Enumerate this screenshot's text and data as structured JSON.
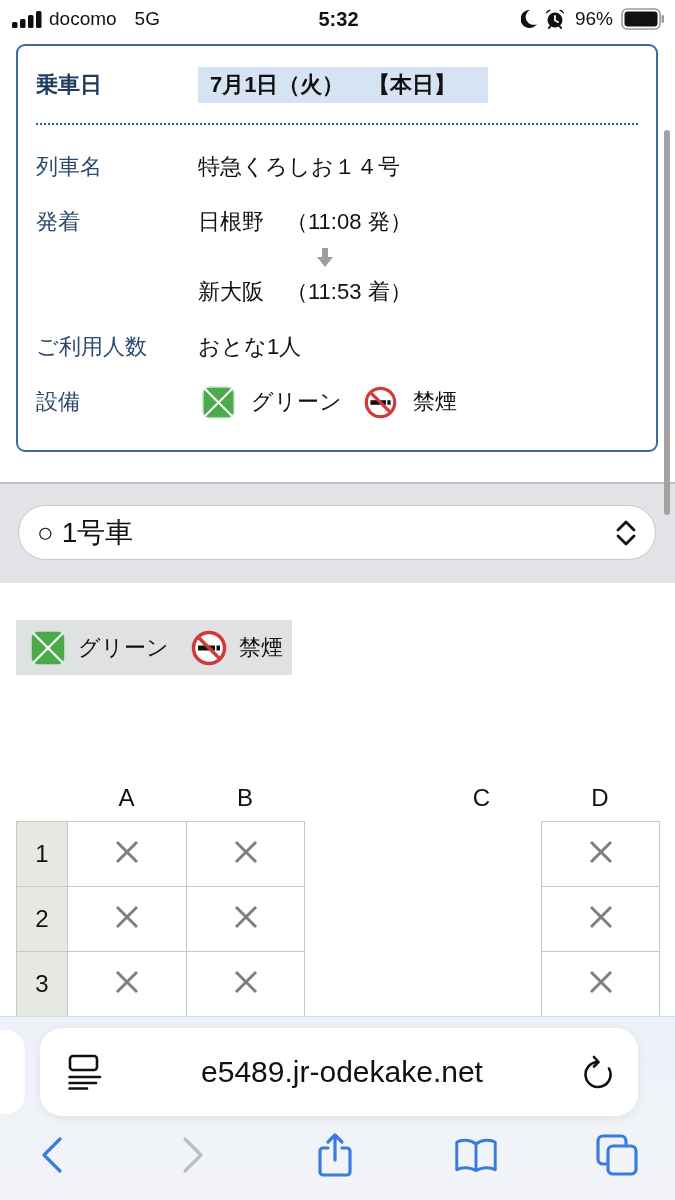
{
  "status_bar": {
    "carrier": "docomo",
    "network": "5G",
    "time": "5:32",
    "battery": "96%"
  },
  "ticket": {
    "date": {
      "label": "乗車日",
      "value": "7月1日（火）",
      "note": "【本日】"
    },
    "rows": [
      {
        "kind": "text",
        "label": "列車名",
        "value": "特急くろしお１４号"
      },
      {
        "kind": "route",
        "label": "発着",
        "departure": {
          "station": "日根野",
          "time": "（11:08 発）"
        },
        "arrival": {
          "station": "新大阪",
          "time": "（11:53 着）"
        }
      },
      {
        "kind": "text",
        "label": "ご利用人数",
        "value": "おとな1人"
      },
      {
        "kind": "facilities",
        "label": "設備",
        "items": [
          {
            "kind": "green",
            "label": "グリーン"
          },
          {
            "kind": "no_smoking",
            "label": "禁煙"
          }
        ]
      }
    ]
  },
  "car_select": {
    "value": "○ 1号車"
  },
  "legend": [
    {
      "kind": "green",
      "label": "グリーン"
    },
    {
      "kind": "no_smoking",
      "label": "禁煙"
    }
  ],
  "seat_map": {
    "columns": [
      {
        "kind": "seat",
        "label": "A"
      },
      {
        "kind": "seat",
        "label": "B"
      },
      {
        "kind": "aisle"
      },
      {
        "kind": "seat",
        "label": "C"
      },
      {
        "kind": "seat",
        "label": "D"
      }
    ],
    "rows": [
      {
        "number": "1",
        "seats": [
          {
            "kind": "seat",
            "available": false
          },
          {
            "kind": "seat",
            "available": false
          },
          {
            "kind": "none"
          },
          {
            "kind": "seat",
            "available": false
          }
        ]
      },
      {
        "number": "2",
        "seats": [
          {
            "kind": "seat",
            "available": false
          },
          {
            "kind": "seat",
            "available": false
          },
          {
            "kind": "none"
          },
          {
            "kind": "seat",
            "available": false
          }
        ]
      },
      {
        "number": "3",
        "seats": [
          {
            "kind": "seat",
            "available": false
          },
          {
            "kind": "seat",
            "available": false
          },
          {
            "kind": "none"
          },
          {
            "kind": "seat",
            "available": false
          }
        ]
      }
    ]
  },
  "browser": {
    "url": "e5489.jr-odekake.net",
    "toolbar": [
      {
        "kind": "back",
        "disabled": false
      },
      {
        "kind": "forward",
        "disabled": true
      },
      {
        "kind": "share",
        "disabled": false
      },
      {
        "kind": "bookmarks",
        "disabled": false
      },
      {
        "kind": "tabs",
        "disabled": false
      }
    ]
  }
}
